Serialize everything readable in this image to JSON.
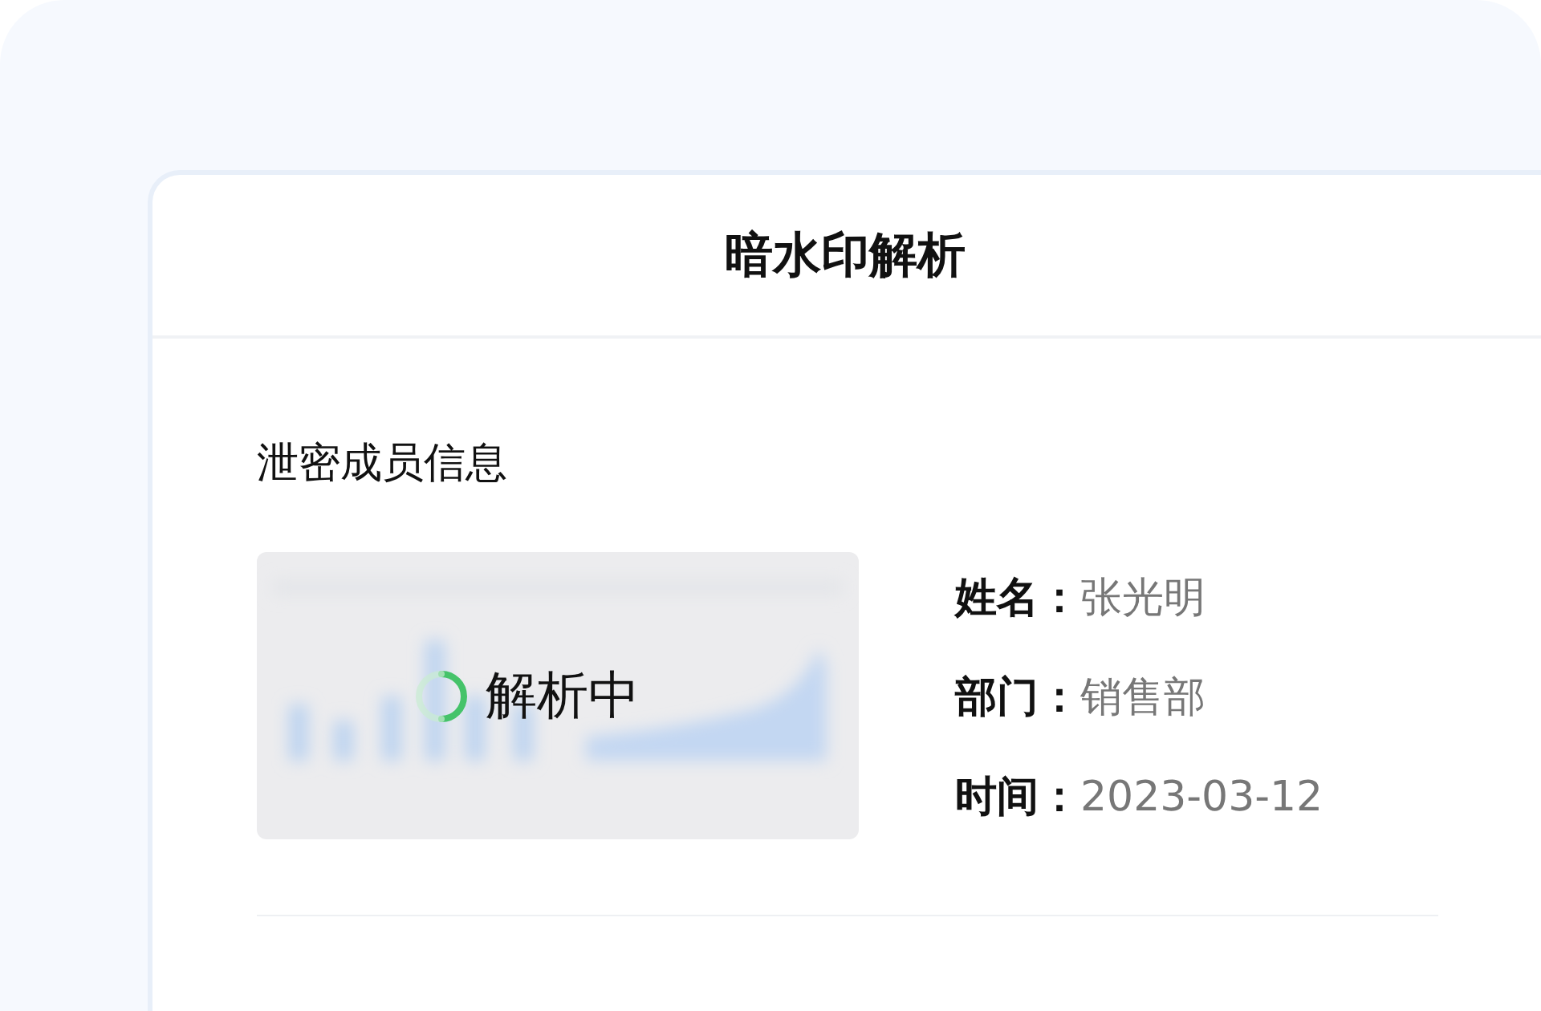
{
  "dialog": {
    "title": "暗水印解析"
  },
  "section": {
    "title": "泄密成员信息"
  },
  "preview": {
    "kind": "picture",
    "status": "解析中"
  },
  "fields": [
    {
      "label": "姓名：",
      "value": "张光明"
    },
    {
      "label": "部门：",
      "value": "销售部"
    },
    {
      "label": "时间：",
      "value": "2023-03-12"
    }
  ]
}
